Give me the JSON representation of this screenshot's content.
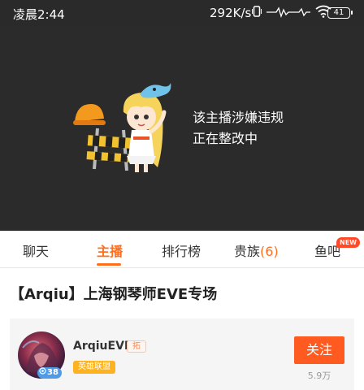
{
  "status_bar": {
    "time": "凌晨2:44",
    "net_speed": "292K/s",
    "battery": "41"
  },
  "video": {
    "notice_line1": "该主播涉嫌违规",
    "notice_line2": "正在整改中"
  },
  "tabs": [
    {
      "label": "聊天"
    },
    {
      "label": "主播"
    },
    {
      "label": "排行榜"
    },
    {
      "label": "贵族",
      "count": "(6)"
    },
    {
      "label": "鱼吧",
      "badge": "NEW"
    }
  ],
  "room": {
    "title": "【Arqiu】上海钢琴师EVE专场"
  },
  "anchor": {
    "name": "ArqiuEVE",
    "badge": "拓",
    "level": "38",
    "category": "英雄联盟",
    "follow_label": "关注",
    "followers": "5.9万"
  },
  "colors": {
    "accent": "#ff6f1f",
    "follow_button": "#ff5a1f",
    "video_bg": "#2b2b2b",
    "category_tag": "#ffb21f"
  }
}
